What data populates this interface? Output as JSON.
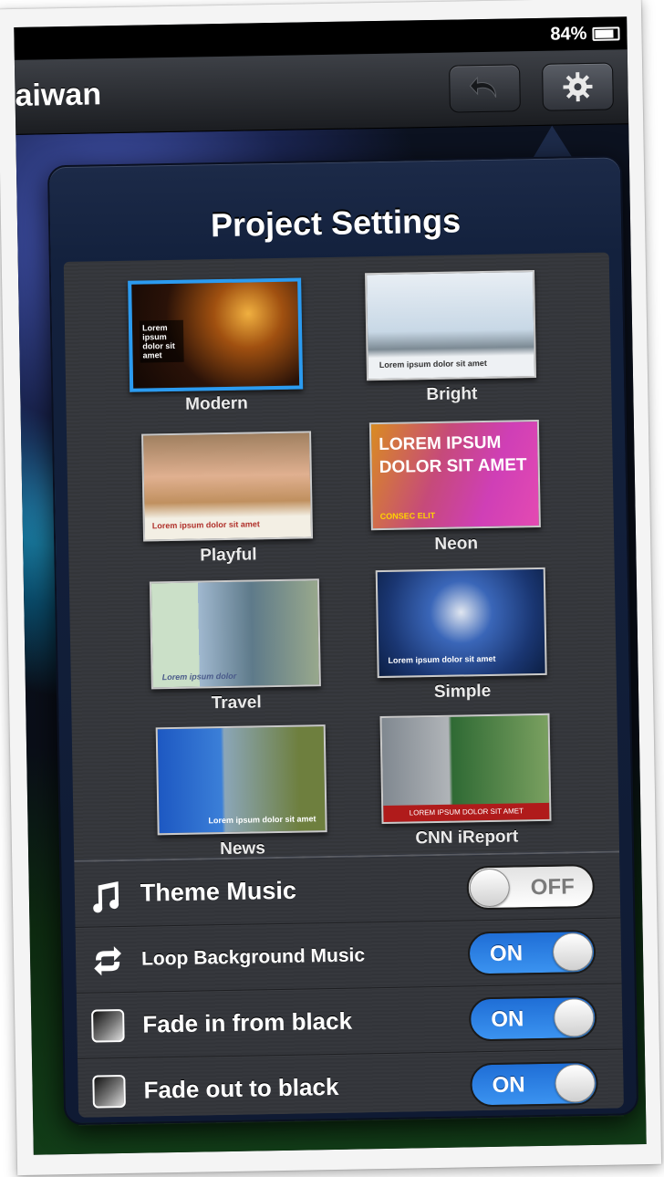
{
  "status_bar": {
    "battery_text": "84%"
  },
  "nav": {
    "title": "aiwan"
  },
  "popover": {
    "title": "Project Settings",
    "themes": [
      {
        "label": "Modern",
        "selected": true
      },
      {
        "label": "Bright",
        "caption": "Lorem ipsum dolor sit amet"
      },
      {
        "label": "Playful",
        "caption": "Lorem ipsum dolor sit amet"
      },
      {
        "label": "Neon",
        "thumb_text": "LOREM IPSUM DOLOR SIT AMET",
        "thumb_sub": "CONSEC ELIT"
      },
      {
        "label": "Travel",
        "caption": "Lorem ipsum dolor"
      },
      {
        "label": "Simple",
        "caption": "Lorem ipsum dolor sit amet"
      },
      {
        "label": "News",
        "caption": "Lorem ipsum dolor sit amet"
      },
      {
        "label": "CNN iReport",
        "caption": "LOREM IPSUM DOLOR SIT AMET"
      }
    ],
    "modern_thumb_text": "Lorem ipsum dolor sit amet",
    "settings": [
      {
        "label": "Theme Music",
        "state": "OFF",
        "icon": "music-note-icon"
      },
      {
        "label": "Loop Background Music",
        "state": "ON",
        "icon": "loop-icon"
      },
      {
        "label": "Fade in from black",
        "state": "ON",
        "icon": "fade-in-icon"
      },
      {
        "label": "Fade out to black",
        "state": "ON",
        "icon": "fade-out-icon"
      }
    ]
  },
  "colors": {
    "selection": "#2b9bf0",
    "toggle_on": "#2f83e6",
    "popover": "#13213d"
  }
}
